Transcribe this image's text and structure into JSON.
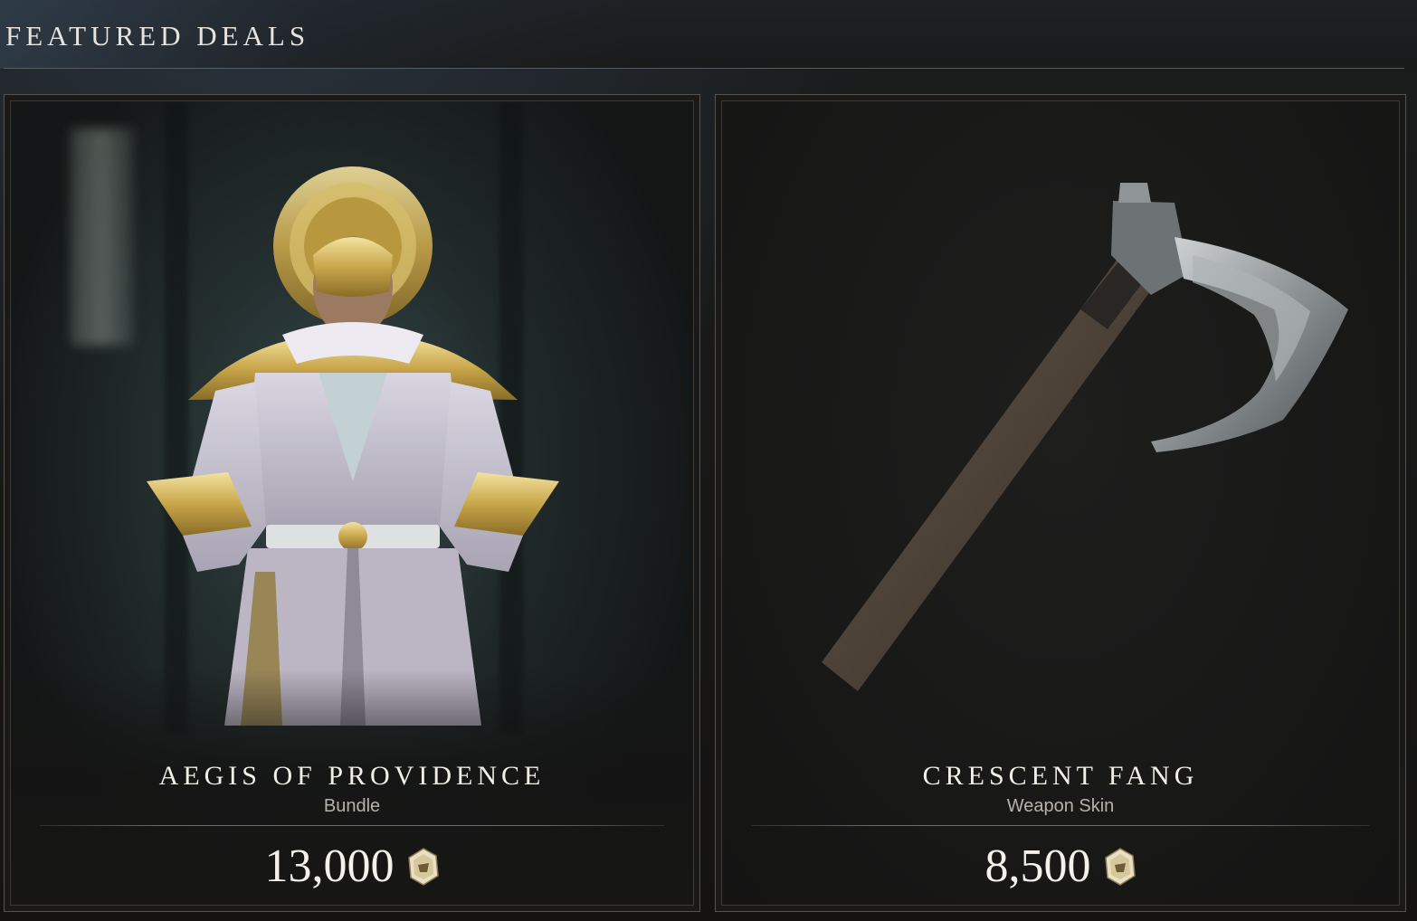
{
  "header": {
    "title": "FEATURED DEALS"
  },
  "deals": [
    {
      "name": "AEGIS OF PROVIDENCE",
      "type": "Bundle",
      "price": "13,000",
      "currency_icon": "coin-icon",
      "image": "armored-character-figure"
    },
    {
      "name": "CRESCENT FANG",
      "type": "Weapon Skin",
      "price": "8,500",
      "currency_icon": "coin-icon",
      "image": "axe-weapon"
    }
  ],
  "colors": {
    "background": "#151413",
    "card_border": "#55534f",
    "title_text": "#f2efe8",
    "subtitle_text": "#b6b2aa",
    "gold_accent": "#c9a64a"
  }
}
